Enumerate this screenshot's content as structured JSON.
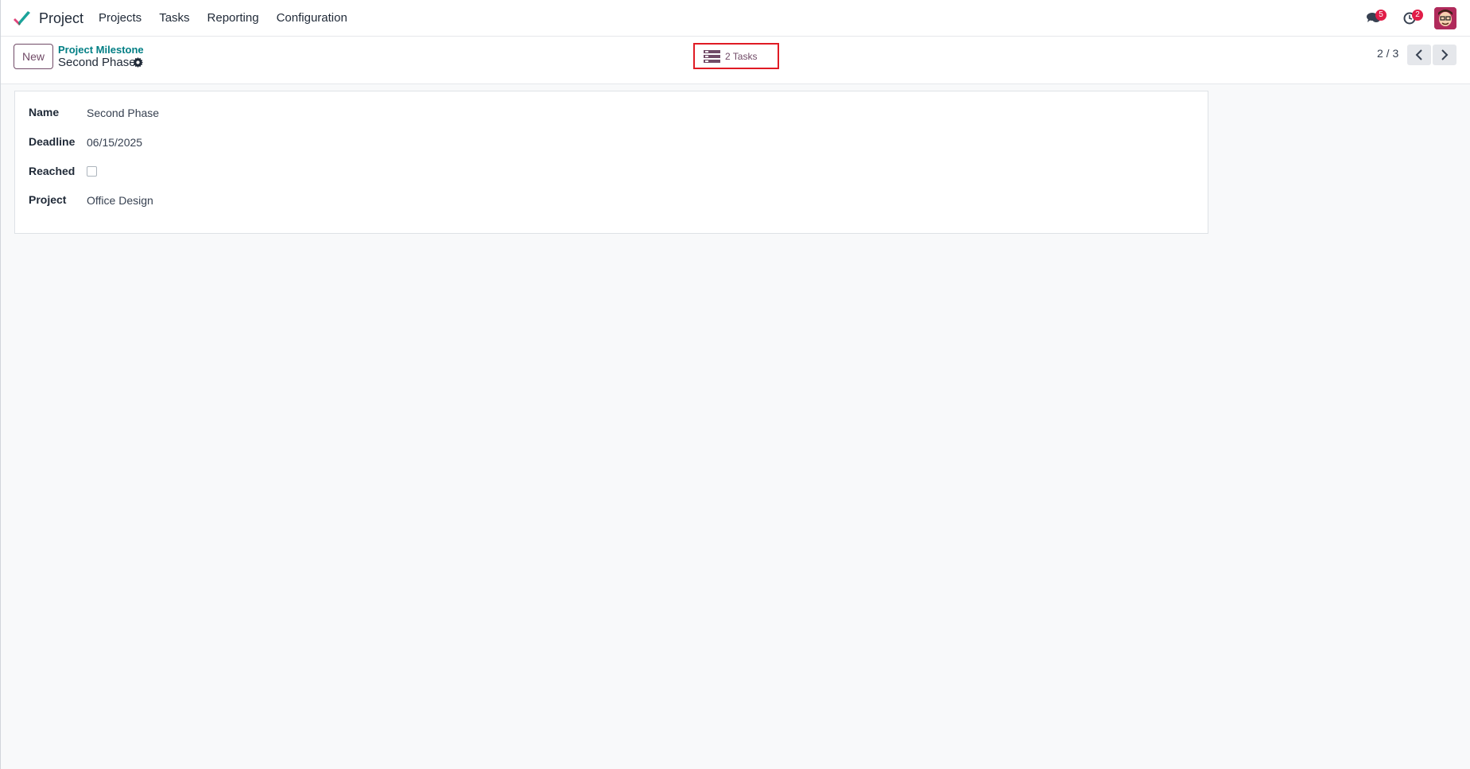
{
  "navbar": {
    "app_name": "Project",
    "menu": [
      "Projects",
      "Tasks",
      "Reporting",
      "Configuration"
    ],
    "messages_badge": "5",
    "activities_badge": "2"
  },
  "control_panel": {
    "new_label": "New",
    "breadcrumb_parent": "Project Milestone",
    "record_title": "Second Phase",
    "smart_button_label": "2 Tasks",
    "pager": "2 / 3"
  },
  "form": {
    "fields": [
      {
        "label": "Name",
        "value": "Second Phase"
      },
      {
        "label": "Deadline",
        "value": "06/15/2025"
      },
      {
        "label": "Reached",
        "value": ""
      },
      {
        "label": "Project",
        "value": "Office Design"
      }
    ],
    "reached_checked": false
  },
  "colors": {
    "accent": "#714b67",
    "link": "#017e84",
    "highlight_border": "#e01b24",
    "badge": "#e11d48"
  },
  "icons": {
    "logo": "project-logo-icon",
    "messages": "chat-bubbles-icon",
    "activities": "clock-icon",
    "settings": "gear-icon",
    "smart_button": "tasks-list-icon",
    "prev": "chevron-left-icon",
    "next": "chevron-right-icon"
  }
}
